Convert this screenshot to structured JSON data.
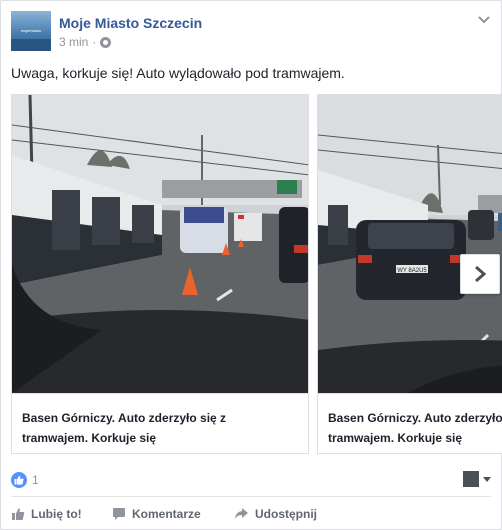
{
  "post": {
    "page_name": "Moje Miasto Szczecin",
    "avatar_text": "mojemiasto",
    "time": "3 min",
    "separator": "·",
    "privacy_icon": "globe-icon",
    "options_icon": "chevron-down-icon",
    "text": "Uwaga, korkuje się! Auto wylądowało pod tramwajem."
  },
  "carousel": {
    "cards": [
      {
        "caption_line1": "Basen Górniczy. Auto zderzyło się z",
        "caption_line2": "tramwajem. Korkuje się",
        "plate_text": ""
      },
      {
        "caption_line1": "Basen Górniczy. Auto zderzyło się z",
        "caption_line2": "tramwajem. Korkuje się",
        "plate_text": "WY 8A2U5"
      }
    ],
    "next_icon": "chevron-right-icon"
  },
  "reactions": {
    "like_icon": "like-thumb-icon",
    "count": "1"
  },
  "actions": {
    "like_label": "Lubię to!",
    "comment_label": "Komentarze",
    "share_label": "Udostępnij"
  },
  "colors": {
    "link_blue": "#365899",
    "like_blue": "#5890ff",
    "muted_gray": "#90949c",
    "action_gray": "#616770"
  }
}
